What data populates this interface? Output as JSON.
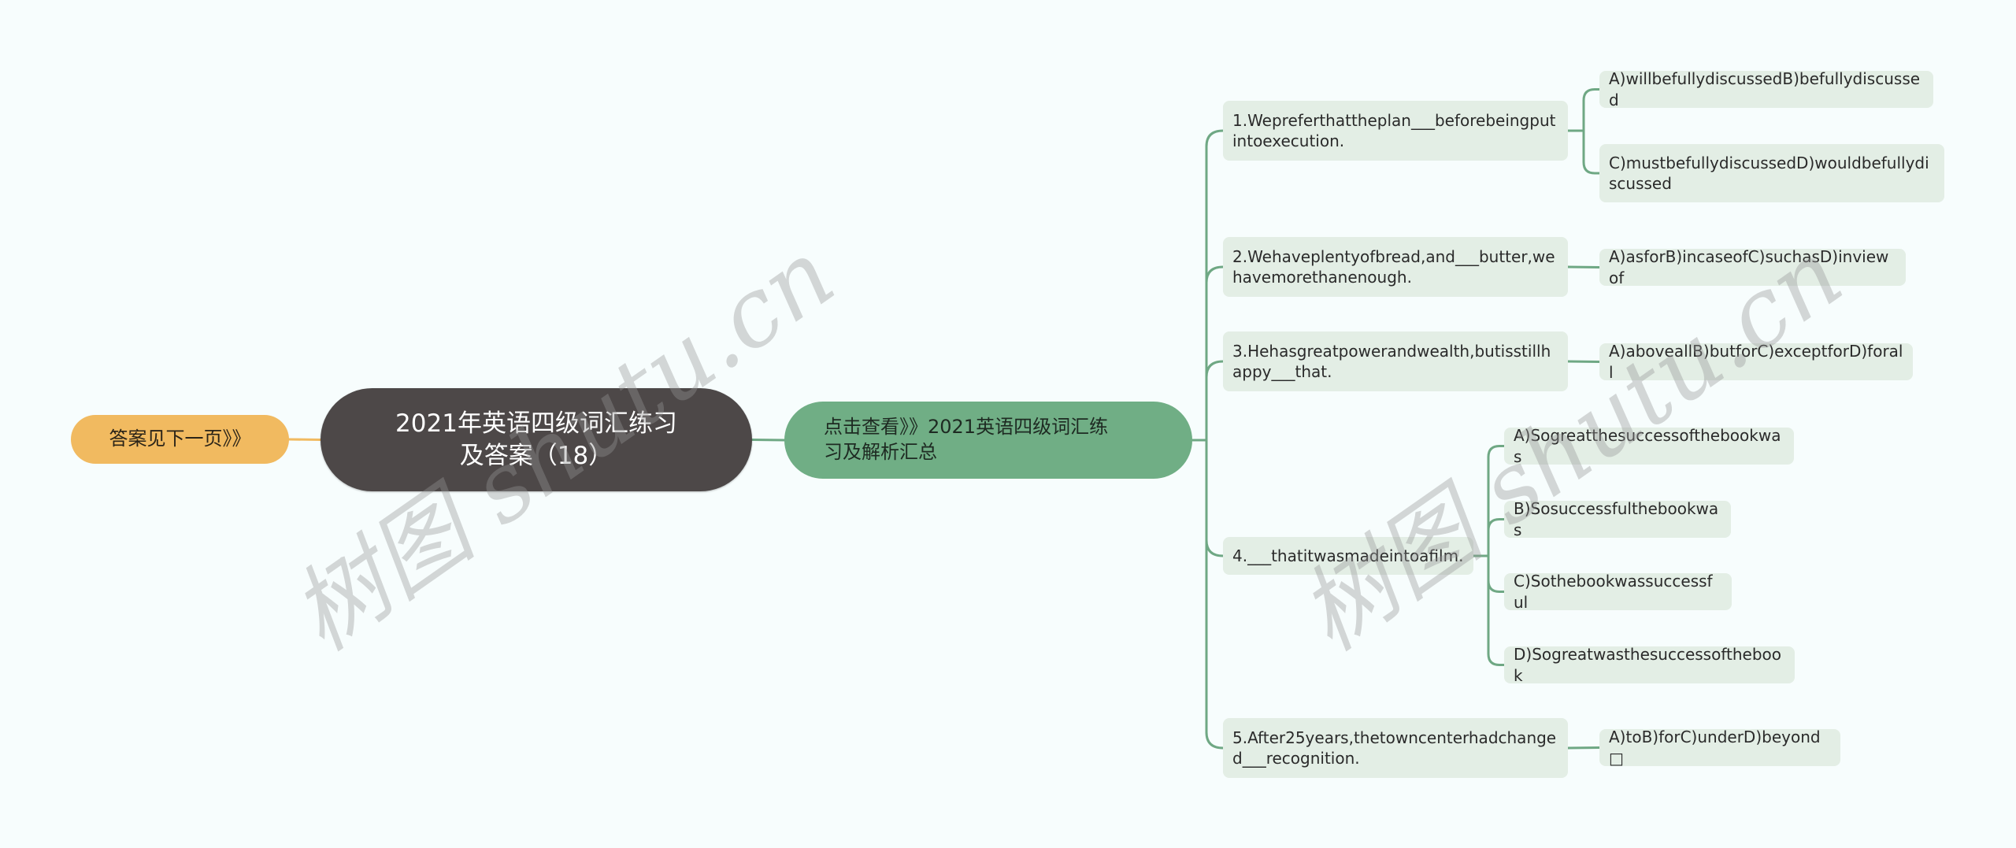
{
  "colors": {
    "background": "#f7fdfd",
    "root": "#4d4848",
    "left_node": "#f1ba60",
    "sub_node": "#70ae85",
    "leaf_node": "#e3eee5",
    "link_green": "#6fa884",
    "link_orange": "#f1ba60"
  },
  "root": {
    "line1": "2021年英语四级词汇练习",
    "line2": "及答案（18）"
  },
  "left_node": {
    "label": "答案见下一页》》"
  },
  "sub_node": {
    "line1": "点击查看》》2021英语四级词汇练",
    "line2": "习及解析汇总"
  },
  "questions": [
    {
      "text": "1.Wepreferthattheplan___beforebeingputintoexecution.",
      "options": [
        "A)willbefullydiscussedB)befullydiscussed",
        "C)mustbefullydiscussedD)wouldbefullydiscussed"
      ]
    },
    {
      "text": "2.Wehaveplentyofbread,and___butter,wehavemorethanenough.",
      "options": [
        "A)asforB)incaseofC)suchasD)inviewof"
      ]
    },
    {
      "text": "3.Hehasgreatpowerandwealth,butisstillhappy___that.",
      "options": [
        "A)aboveallB)butforC)exceptforD)forall"
      ]
    },
    {
      "text": "4.___thatitwasmadeintoafilm.",
      "options": [
        "A)Sogreatthesuccessofthebookwas",
        "B)Sosuccessfulthebookwas",
        "C)Sothebookwassuccessful",
        "D)Sogreatwasthesuccessofthebook"
      ]
    },
    {
      "text": "5.After25years,thetowncenterhadchanged___recognition.",
      "options": [
        "A)toB)forC)underD)beyond□"
      ]
    }
  ],
  "watermarks": [
    "树图 shutu.cn",
    "树图 shutu.cn"
  ]
}
